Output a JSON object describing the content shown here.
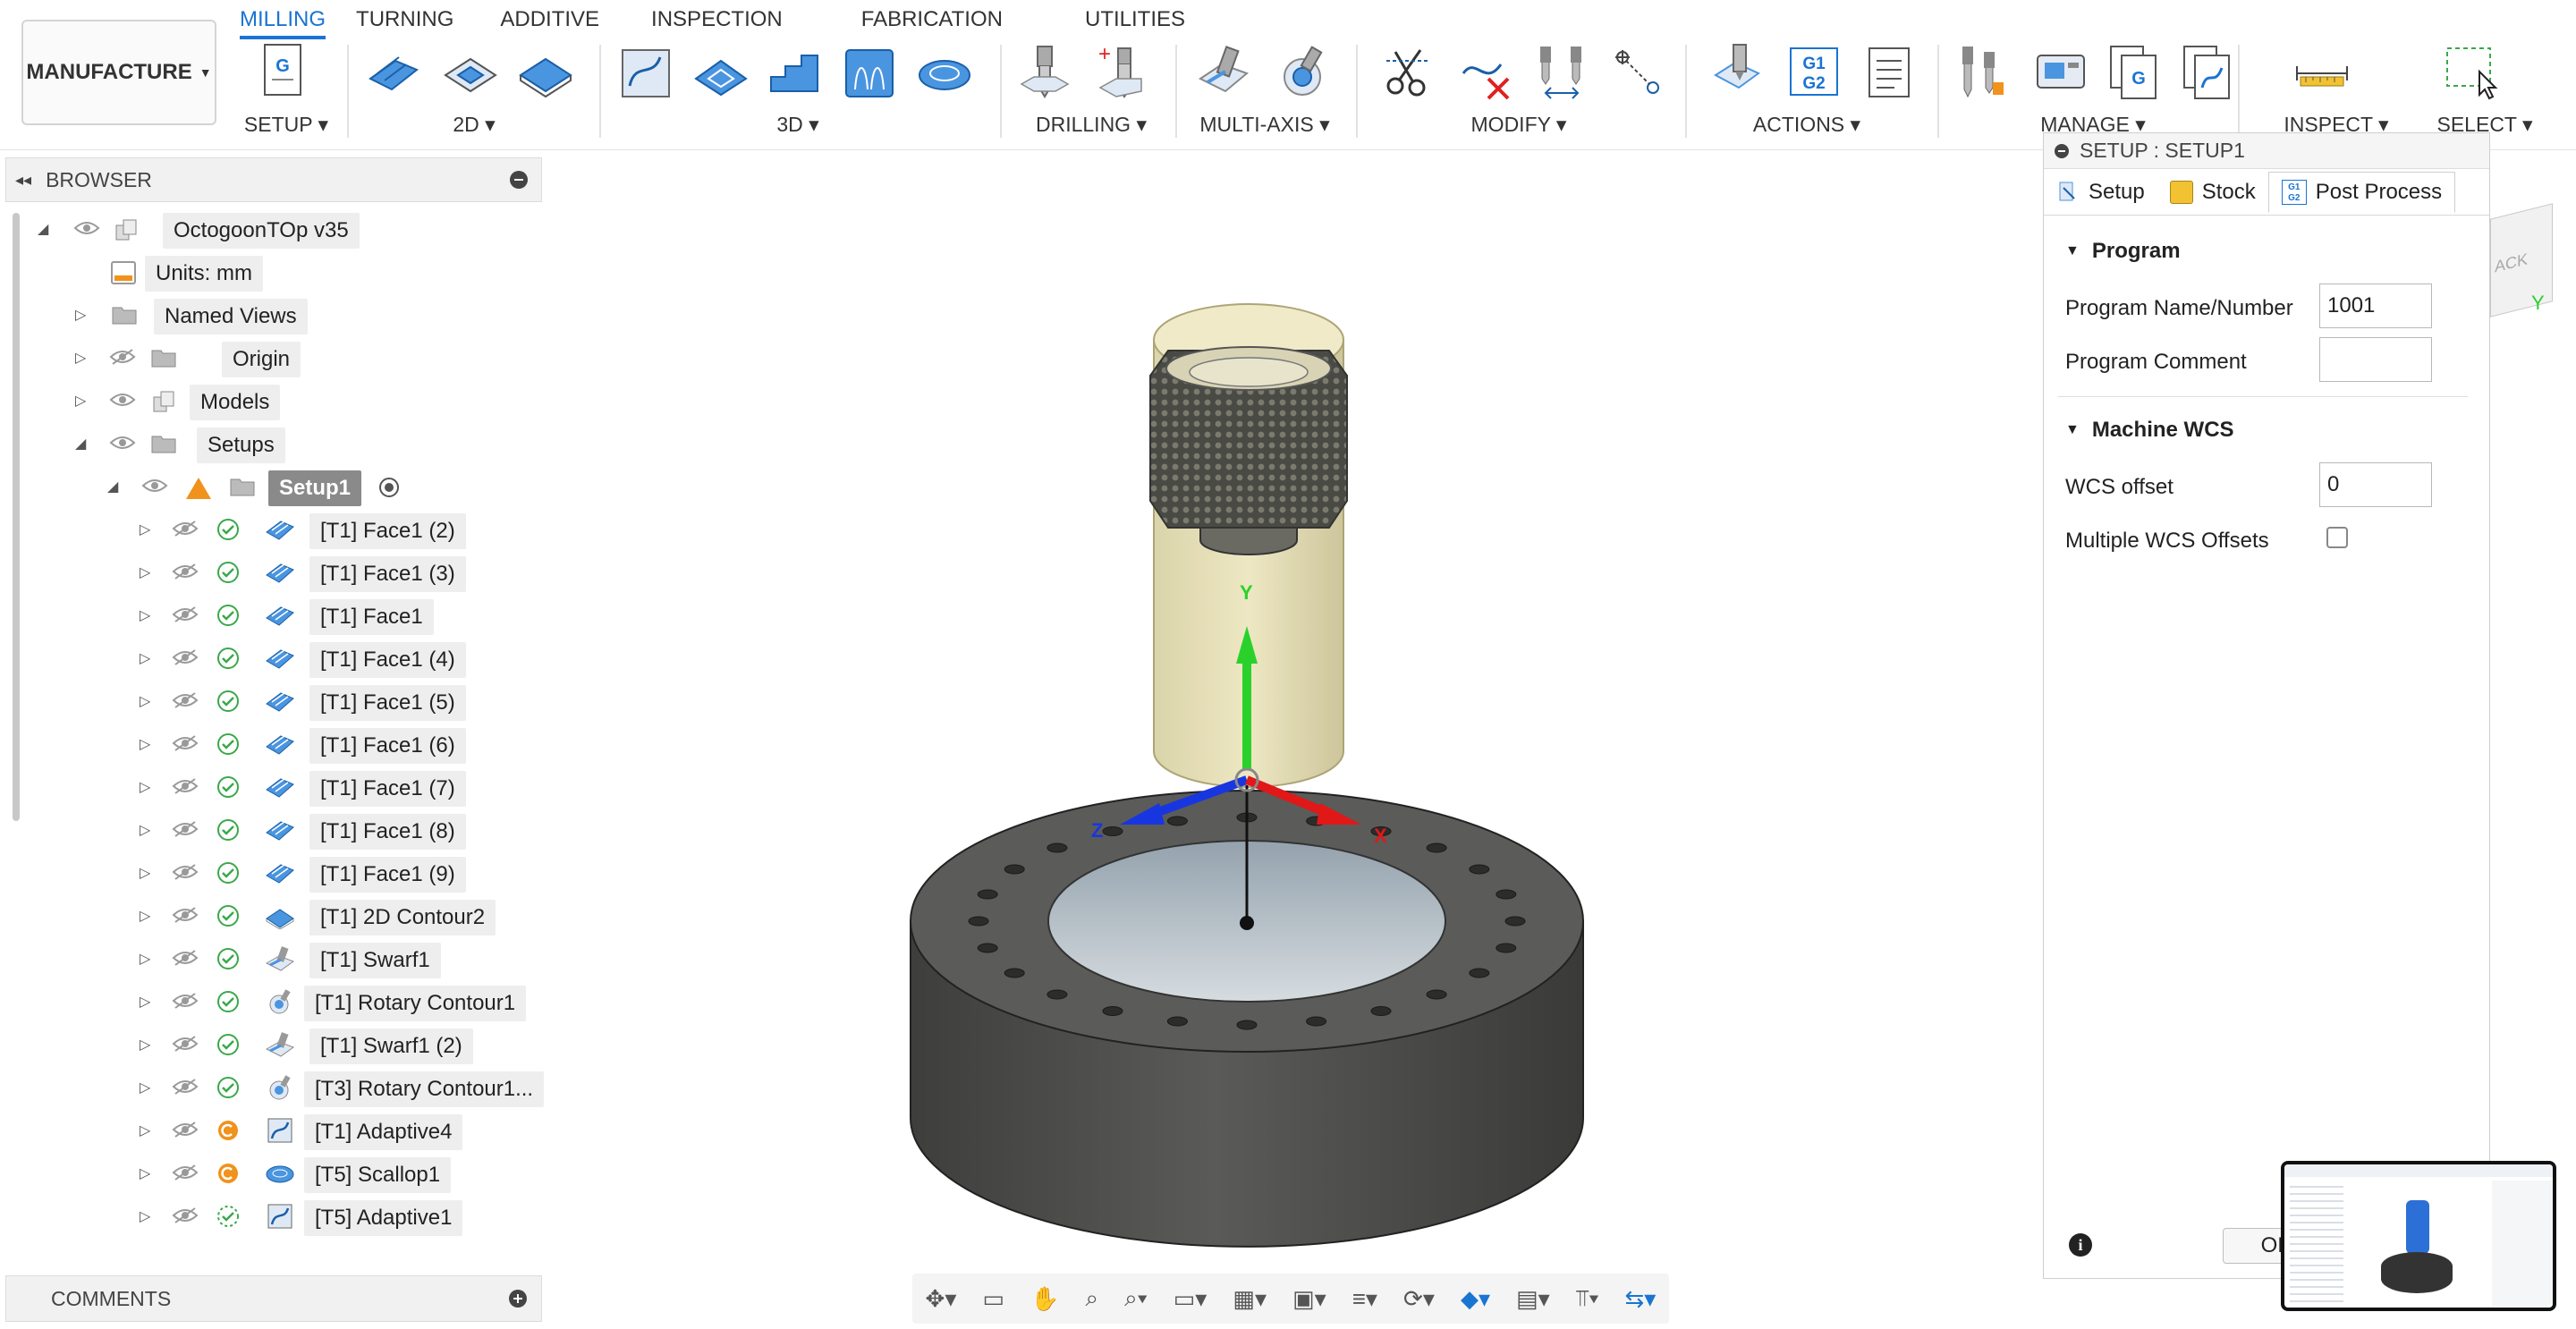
{
  "workspace": {
    "label": "MANUFACTURE"
  },
  "tabs": [
    {
      "label": "MILLING",
      "active": true
    },
    {
      "label": "TURNING"
    },
    {
      "label": "ADDITIVE"
    },
    {
      "label": "INSPECTION"
    },
    {
      "label": "FABRICATION"
    },
    {
      "label": "UTILITIES"
    }
  ],
  "groups": {
    "setup": "SETUP",
    "g2d": "2D",
    "g3d": "3D",
    "drilling": "DRILLING",
    "multiaxis": "MULTI-AXIS",
    "modify": "MODIFY",
    "actions": "ACTIONS",
    "manage": "MANAGE",
    "inspect": "INSPECT",
    "select": "SELECT",
    "g1g2_icon": "G1\nG2"
  },
  "browser": {
    "title": "BROWSER",
    "root": "OctogoonTOp v35",
    "units": "Units: mm",
    "named_views": "Named Views",
    "origin": "Origin",
    "models": "Models",
    "setups": "Setups",
    "setup1": "Setup1",
    "ops": [
      {
        "label": "[T1] Face1 (2)",
        "status": "ok",
        "icon": "face"
      },
      {
        "label": "[T1] Face1 (3)",
        "status": "ok",
        "icon": "face"
      },
      {
        "label": "[T1] Face1",
        "status": "ok",
        "icon": "face"
      },
      {
        "label": "[T1] Face1 (4)",
        "status": "ok",
        "icon": "face"
      },
      {
        "label": "[T1] Face1 (5)",
        "status": "ok",
        "icon": "face"
      },
      {
        "label": "[T1] Face1 (6)",
        "status": "ok",
        "icon": "face"
      },
      {
        "label": "[T1] Face1 (7)",
        "status": "ok",
        "icon": "face"
      },
      {
        "label": "[T1] Face1 (8)",
        "status": "ok",
        "icon": "face"
      },
      {
        "label": "[T1] Face1 (9)",
        "status": "ok",
        "icon": "face"
      },
      {
        "label": "[T1] 2D Contour2",
        "status": "ok",
        "icon": "contour"
      },
      {
        "label": "[T1] Swarf1",
        "status": "ok",
        "icon": "swarf"
      },
      {
        "label": "[T1] Rotary Contour1",
        "status": "ok",
        "icon": "rotary"
      },
      {
        "label": "[T1] Swarf1 (2)",
        "status": "ok",
        "icon": "swarf"
      },
      {
        "label": "[T3] Rotary Contour1...",
        "status": "ok",
        "icon": "rotary"
      },
      {
        "label": "[T1] Adaptive4",
        "status": "pending",
        "icon": "adaptive"
      },
      {
        "label": "[T5] Scallop1",
        "status": "pending",
        "icon": "scallop"
      },
      {
        "label": "[T5] Adaptive1",
        "status": "dashed",
        "icon": "adaptive"
      }
    ]
  },
  "comments": {
    "label": "COMMENTS"
  },
  "axes": {
    "x": "X",
    "y": "Y",
    "z": "Z"
  },
  "setup_panel": {
    "title": "SETUP : SETUP1",
    "tabs": [
      "Setup",
      "Stock",
      "Post Process"
    ],
    "program_section": "Program",
    "program_name_label": "Program Name/Number",
    "program_name_value": "1001",
    "program_comment_label": "Program Comment",
    "program_comment_value": "",
    "wcs_section": "Machine WCS",
    "wcs_offset_label": "WCS offset",
    "wcs_offset_value": "0",
    "multiple_wcs_label": "Multiple WCS Offsets",
    "multiple_wcs_checked": false,
    "ok_label": "OK"
  },
  "viewcube": {
    "face_label": "ACK",
    "axis_y": "Y"
  },
  "colors": {
    "accent": "#1a74d2",
    "green_check": "#3aa84a",
    "orange": "#f0921c"
  }
}
